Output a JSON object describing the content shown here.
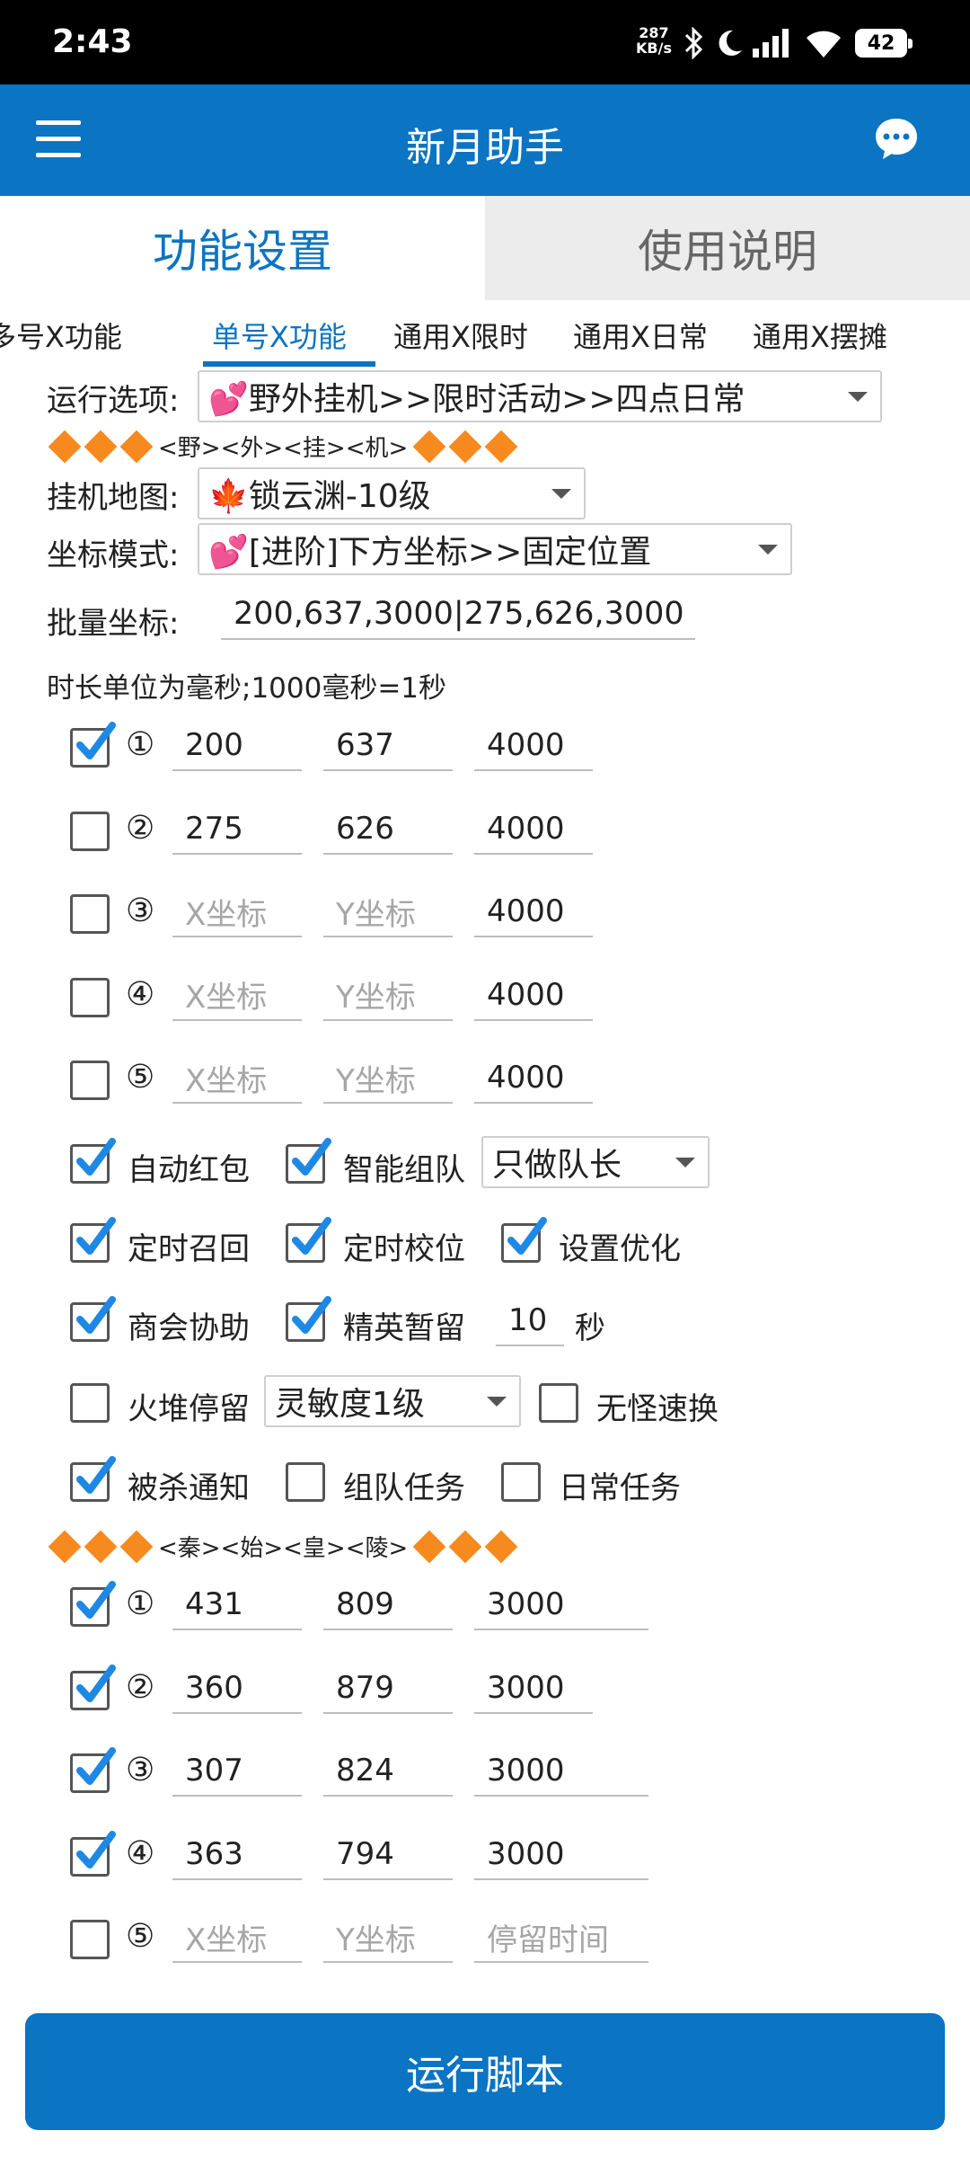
{
  "status_bar": {
    "time": "2:43",
    "net_speed": "287",
    "net_unit": "KB/s",
    "battery": "42"
  },
  "app_bar": {
    "title": "新月助手"
  },
  "main_tabs": [
    {
      "label": "功能设置",
      "active": true
    },
    {
      "label": "使用说明",
      "active": false
    }
  ],
  "sub_tabs": [
    {
      "label": "多号X功能"
    },
    {
      "label": "单号X功能",
      "active": true
    },
    {
      "label": "通用X限时"
    },
    {
      "label": "通用X日常"
    },
    {
      "label": "通用X摆摊"
    }
  ],
  "form": {
    "run_option_label": "运行选项:",
    "run_option_value": "💕野外挂机>>限时活动>>四点日常",
    "section1_title": "<野><外><挂><机>",
    "map_label": "挂机地图:",
    "map_value": "🍁锁云渊-10级",
    "coord_mode_label": "坐标模式:",
    "coord_mode_value": "💕[进阶]下方坐标>>固定位置",
    "batch_label": "批量坐标:",
    "batch_value": "200,637,3000|275,626,3000",
    "hint": "时长单位为毫秒;1000毫秒=1秒"
  },
  "coord_rows_1": [
    {
      "num": "①",
      "checked": true,
      "x": "200",
      "y": "637",
      "t": "4000"
    },
    {
      "num": "②",
      "checked": false,
      "x": "275",
      "y": "626",
      "t": "4000"
    },
    {
      "num": "③",
      "checked": false,
      "x": "",
      "y": "",
      "t": "4000"
    },
    {
      "num": "④",
      "checked": false,
      "x": "",
      "y": "",
      "t": "4000"
    },
    {
      "num": "⑤",
      "checked": false,
      "x": "",
      "y": "",
      "t": "4000"
    }
  ],
  "placeholders": {
    "x": "X坐标",
    "y": "Y坐标",
    "stay": "停留时间"
  },
  "options": {
    "auto_redpacket": {
      "label": "自动红包",
      "checked": true
    },
    "smart_team": {
      "label": "智能组队",
      "checked": true
    },
    "team_mode": "只做队长",
    "timed_recall": {
      "label": "定时召回",
      "checked": true
    },
    "timed_calibrate": {
      "label": "定时校位",
      "checked": true
    },
    "setting_optimize": {
      "label": "设置优化",
      "checked": true
    },
    "guild_assist": {
      "label": "商会协助",
      "checked": true
    },
    "elite_stay": {
      "label": "精英暂留",
      "checked": true
    },
    "elite_seconds": "10",
    "seconds_unit": "秒",
    "campfire_stay": {
      "label": "火堆停留",
      "checked": false
    },
    "sensitivity": "灵敏度1级",
    "no_monster_switch": {
      "label": "无怪速换",
      "checked": false
    },
    "killed_notify": {
      "label": "被杀通知",
      "checked": true
    },
    "team_task": {
      "label": "组队任务",
      "checked": false
    },
    "daily_task": {
      "label": "日常任务",
      "checked": false
    }
  },
  "section2_title": "<秦><始><皇><陵>",
  "coord_rows_2": [
    {
      "num": "①",
      "checked": true,
      "x": "431",
      "y": "809",
      "t": "3000"
    },
    {
      "num": "②",
      "checked": true,
      "x": "360",
      "y": "879",
      "t": "3000"
    },
    {
      "num": "③",
      "checked": true,
      "x": "307",
      "y": "824",
      "t": "3000"
    },
    {
      "num": "④",
      "checked": true,
      "x": "363",
      "y": "794",
      "t": "3000"
    },
    {
      "num": "⑤",
      "checked": false,
      "x": "",
      "y": "",
      "t": ""
    }
  ],
  "run_button": "运行脚本",
  "colors": {
    "primary": "#0b74c3",
    "diamond": "#f68a1e",
    "check": "#1e88e5"
  }
}
